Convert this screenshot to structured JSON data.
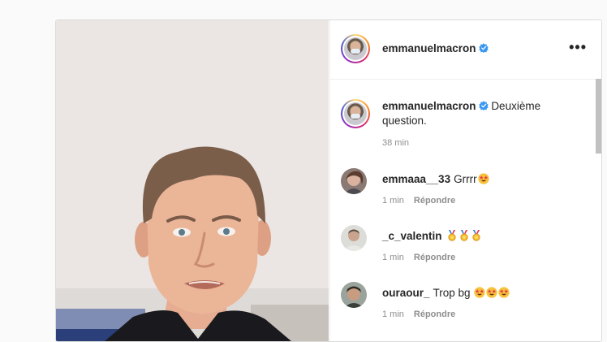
{
  "post": {
    "author": "emmanuelmacron",
    "verified": true,
    "caption": "Deuxième question.",
    "caption_time": "38 min"
  },
  "menu": {
    "more_label": "•••"
  },
  "comments": [
    {
      "user": "emmaaa__33",
      "text": "Grrrr",
      "emojis": [
        "star-struck"
      ],
      "time": "1 min",
      "reply_label": "Répondre"
    },
    {
      "user": "_c_valentin",
      "text": "",
      "emojis": [
        "medal",
        "medal",
        "medal"
      ],
      "time": "1 min",
      "reply_label": "Répondre"
    },
    {
      "user": "ouraour_",
      "text": "Trop bg",
      "emojis": [
        "star-struck",
        "star-struck",
        "star-struck"
      ],
      "time": "1 min",
      "reply_label": "Répondre"
    }
  ],
  "colors": {
    "verified": "#3897f0",
    "meta_text": "#8e8e8e",
    "border": "#dbdbdb"
  }
}
